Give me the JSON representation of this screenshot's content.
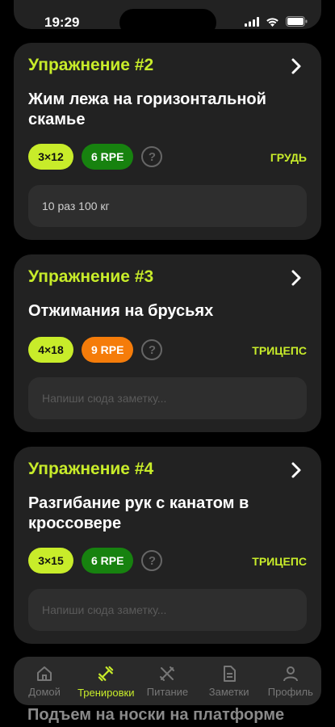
{
  "status_bar": {
    "time": "19:29"
  },
  "exercises": [
    {
      "number": "Упражнение #2",
      "title": "Жим лежа на горизонтальной скамье",
      "sets": "3×12",
      "rpe": "6 RPE",
      "rpe_color": "#17820f",
      "help": "?",
      "muscle": "ГРУДЬ",
      "note": "10 раз 100 кг",
      "note_placeholder": ""
    },
    {
      "number": "Упражнение #3",
      "title": "Отжимания на брусьях",
      "sets": "4×18",
      "rpe": "9 RPE",
      "rpe_color": "#f57c0a",
      "help": "?",
      "muscle": "ТРИЦЕПС",
      "note": "",
      "note_placeholder": "Напиши сюда заметку..."
    },
    {
      "number": "Упражнение #4",
      "title": "Разгибание рук с канатом в кроссовере",
      "sets": "3×15",
      "rpe": "6 RPE",
      "rpe_color": "#17820f",
      "help": "?",
      "muscle": "ТРИЦЕПС",
      "note": "",
      "note_placeholder": "Напиши сюда заметку..."
    }
  ],
  "peek_title": "Подъем на носки на платформе",
  "tabbar": {
    "items": [
      {
        "label": "Домой",
        "icon": "home-icon"
      },
      {
        "label": "Тренировки",
        "icon": "dumbbell-icon"
      },
      {
        "label": "Питание",
        "icon": "utensils-icon"
      },
      {
        "label": "Заметки",
        "icon": "document-icon"
      },
      {
        "label": "Профиль",
        "icon": "profile-icon"
      }
    ],
    "active_index": 1
  },
  "colors": {
    "accent": "#c8ec2a",
    "card_bg": "#222222",
    "background": "#000000"
  }
}
